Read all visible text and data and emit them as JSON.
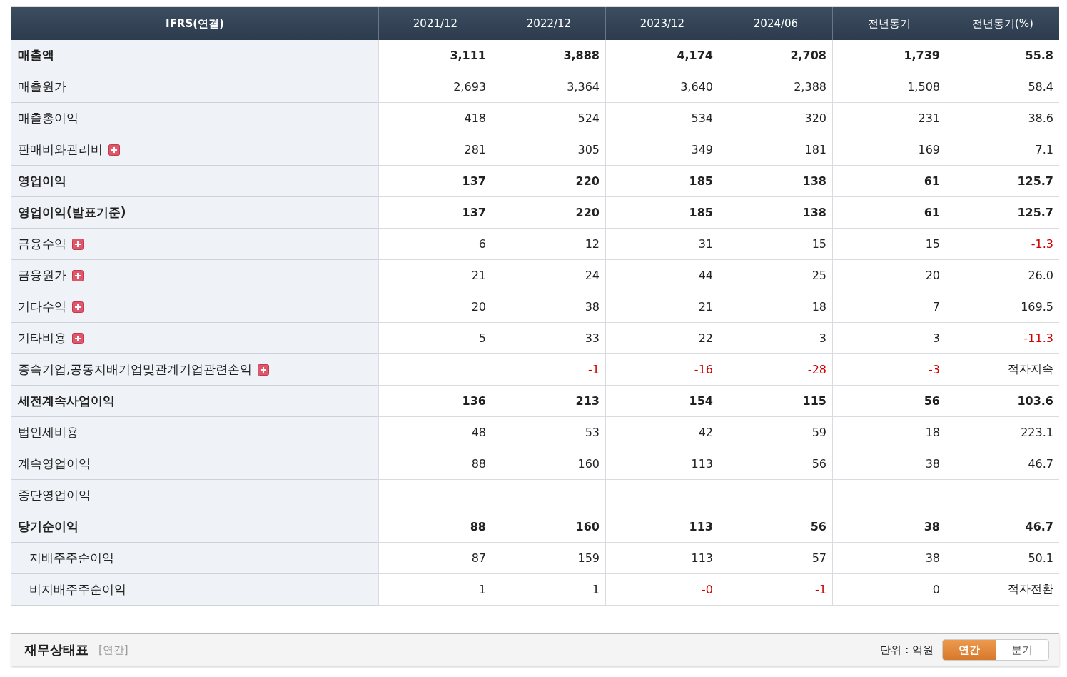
{
  "table": {
    "columns": [
      "IFRS(연결)",
      "2021/12",
      "2022/12",
      "2023/12",
      "2024/06",
      "전년동기",
      "전년동기(%)"
    ],
    "rows": [
      {
        "label": "매출액",
        "bold": true,
        "expandable": false,
        "cells": [
          {
            "text": "3,111",
            "negative": false
          },
          {
            "text": "3,888",
            "negative": false
          },
          {
            "text": "4,174",
            "negative": false
          },
          {
            "text": "2,708",
            "negative": false
          },
          {
            "text": "1,739",
            "negative": false
          },
          {
            "text": "55.8",
            "negative": false
          }
        ]
      },
      {
        "label": "매출원가",
        "bold": false,
        "expandable": false,
        "cells": [
          {
            "text": "2,693",
            "negative": false
          },
          {
            "text": "3,364",
            "negative": false
          },
          {
            "text": "3,640",
            "negative": false
          },
          {
            "text": "2,388",
            "negative": false
          },
          {
            "text": "1,508",
            "negative": false
          },
          {
            "text": "58.4",
            "negative": false
          }
        ]
      },
      {
        "label": "매출총이익",
        "bold": false,
        "expandable": false,
        "cells": [
          {
            "text": "418",
            "negative": false
          },
          {
            "text": "524",
            "negative": false
          },
          {
            "text": "534",
            "negative": false
          },
          {
            "text": "320",
            "negative": false
          },
          {
            "text": "231",
            "negative": false
          },
          {
            "text": "38.6",
            "negative": false
          }
        ]
      },
      {
        "label": "판매비와관리비",
        "bold": false,
        "expandable": true,
        "cells": [
          {
            "text": "281",
            "negative": false
          },
          {
            "text": "305",
            "negative": false
          },
          {
            "text": "349",
            "negative": false
          },
          {
            "text": "181",
            "negative": false
          },
          {
            "text": "169",
            "negative": false
          },
          {
            "text": "7.1",
            "negative": false
          }
        ]
      },
      {
        "label": "영업이익",
        "bold": true,
        "expandable": false,
        "cells": [
          {
            "text": "137",
            "negative": false
          },
          {
            "text": "220",
            "negative": false
          },
          {
            "text": "185",
            "negative": false
          },
          {
            "text": "138",
            "negative": false
          },
          {
            "text": "61",
            "negative": false
          },
          {
            "text": "125.7",
            "negative": false
          }
        ]
      },
      {
        "label": "영업이익(발표기준)",
        "bold": true,
        "expandable": false,
        "cells": [
          {
            "text": "137",
            "negative": false
          },
          {
            "text": "220",
            "negative": false
          },
          {
            "text": "185",
            "negative": false
          },
          {
            "text": "138",
            "negative": false
          },
          {
            "text": "61",
            "negative": false
          },
          {
            "text": "125.7",
            "negative": false
          }
        ]
      },
      {
        "label": "금융수익",
        "bold": false,
        "expandable": true,
        "cells": [
          {
            "text": "6",
            "negative": false
          },
          {
            "text": "12",
            "negative": false
          },
          {
            "text": "31",
            "negative": false
          },
          {
            "text": "15",
            "negative": false
          },
          {
            "text": "15",
            "negative": false
          },
          {
            "text": "-1.3",
            "negative": true
          }
        ]
      },
      {
        "label": "금융원가",
        "bold": false,
        "expandable": true,
        "cells": [
          {
            "text": "21",
            "negative": false
          },
          {
            "text": "24",
            "negative": false
          },
          {
            "text": "44",
            "negative": false
          },
          {
            "text": "25",
            "negative": false
          },
          {
            "text": "20",
            "negative": false
          },
          {
            "text": "26.0",
            "negative": false
          }
        ]
      },
      {
        "label": "기타수익",
        "bold": false,
        "expandable": true,
        "cells": [
          {
            "text": "20",
            "negative": false
          },
          {
            "text": "38",
            "negative": false
          },
          {
            "text": "21",
            "negative": false
          },
          {
            "text": "18",
            "negative": false
          },
          {
            "text": "7",
            "negative": false
          },
          {
            "text": "169.5",
            "negative": false
          }
        ]
      },
      {
        "label": "기타비용",
        "bold": false,
        "expandable": true,
        "cells": [
          {
            "text": "5",
            "negative": false
          },
          {
            "text": "33",
            "negative": false
          },
          {
            "text": "22",
            "negative": false
          },
          {
            "text": "3",
            "negative": false
          },
          {
            "text": "3",
            "negative": false
          },
          {
            "text": "-11.3",
            "negative": true
          }
        ]
      },
      {
        "label": "종속기업,공동지배기업및관계기업관련손익",
        "bold": false,
        "expandable": true,
        "cells": [
          null,
          {
            "text": "-1",
            "negative": true
          },
          {
            "text": "-16",
            "negative": true
          },
          {
            "text": "-28",
            "negative": true
          },
          {
            "text": "-3",
            "negative": true
          },
          {
            "text": "적자지속",
            "negative": false
          }
        ]
      },
      {
        "label": "세전계속사업이익",
        "bold": true,
        "expandable": false,
        "cells": [
          {
            "text": "136",
            "negative": false
          },
          {
            "text": "213",
            "negative": false
          },
          {
            "text": "154",
            "negative": false
          },
          {
            "text": "115",
            "negative": false
          },
          {
            "text": "56",
            "negative": false
          },
          {
            "text": "103.6",
            "negative": false
          }
        ]
      },
      {
        "label": "법인세비용",
        "bold": false,
        "expandable": false,
        "cells": [
          {
            "text": "48",
            "negative": false
          },
          {
            "text": "53",
            "negative": false
          },
          {
            "text": "42",
            "negative": false
          },
          {
            "text": "59",
            "negative": false
          },
          {
            "text": "18",
            "negative": false
          },
          {
            "text": "223.1",
            "negative": false
          }
        ]
      },
      {
        "label": "계속영업이익",
        "bold": false,
        "expandable": false,
        "cells": [
          {
            "text": "88",
            "negative": false
          },
          {
            "text": "160",
            "negative": false
          },
          {
            "text": "113",
            "negative": false
          },
          {
            "text": "56",
            "negative": false
          },
          {
            "text": "38",
            "negative": false
          },
          {
            "text": "46.7",
            "negative": false
          }
        ]
      },
      {
        "label": "중단영업이익",
        "bold": false,
        "expandable": false,
        "cells": [
          null,
          null,
          null,
          null,
          null,
          null
        ]
      },
      {
        "label": "당기순이익",
        "bold": true,
        "expandable": false,
        "cells": [
          {
            "text": "88",
            "negative": false
          },
          {
            "text": "160",
            "negative": false
          },
          {
            "text": "113",
            "negative": false
          },
          {
            "text": "56",
            "negative": false
          },
          {
            "text": "38",
            "negative": false
          },
          {
            "text": "46.7",
            "negative": false
          }
        ],
        "children": [
          {
            "label": "지배주주순이익",
            "bold": false,
            "expandable": false,
            "cells": [
              {
                "text": "87",
                "negative": false
              },
              {
                "text": "159",
                "negative": false
              },
              {
                "text": "113",
                "negative": false
              },
              {
                "text": "57",
                "negative": false
              },
              {
                "text": "38",
                "negative": false
              },
              {
                "text": "50.1",
                "negative": false
              }
            ]
          },
          {
            "label": "비지배주주순이익",
            "bold": false,
            "expandable": false,
            "cells": [
              {
                "text": "1",
                "negative": false
              },
              {
                "text": "1",
                "negative": false
              },
              {
                "text": "-0",
                "negative": true
              },
              {
                "text": "-1",
                "negative": true
              },
              {
                "text": "0",
                "negative": false
              },
              {
                "text": "적자전환",
                "negative": false
              }
            ]
          }
        ]
      }
    ]
  },
  "section": {
    "title": "재무상태표",
    "period": "[연간]",
    "unit": "단위 : 억원",
    "toggles": [
      {
        "label": "연간",
        "selected": true
      },
      {
        "label": "분기",
        "selected": false
      }
    ]
  }
}
